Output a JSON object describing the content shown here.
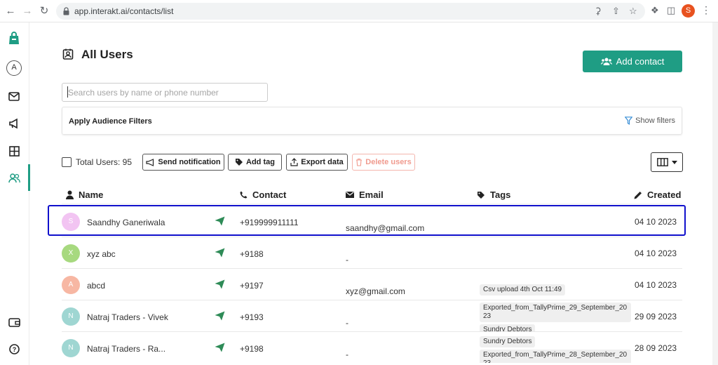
{
  "browser": {
    "url": "app.interakt.ai/contacts/list",
    "profile_initial": "S"
  },
  "page": {
    "title": "All Users",
    "add_contact_label": "Add contact"
  },
  "search": {
    "placeholder": "Search users by name or phone number"
  },
  "filters": {
    "label": "Apply Audience Filters",
    "show_label": "Show filters"
  },
  "toolbar": {
    "total_users": "Total Users: 95",
    "send_notification": "Send notification",
    "add_tag": "Add tag",
    "export_data": "Export data",
    "delete_users": "Delete users"
  },
  "columns": {
    "name": "Name",
    "contact": "Contact",
    "email": "Email",
    "tags": "Tags",
    "created": "Created"
  },
  "colors": {
    "accent": "#1f9d84",
    "highlight": "#1010cc",
    "delete_disabled": "#f09a8e"
  },
  "rows": [
    {
      "initial": "S",
      "name": "Saandhy Ganeriwala",
      "contact": "+919999911111",
      "email": "saandhy@gmail.com",
      "tags": [],
      "created": "04 10 2023",
      "avatar_color": "#f2c4f2"
    },
    {
      "initial": "X",
      "name": "xyz abc",
      "contact": "+9188",
      "email": "-",
      "tags": [],
      "created": "04 10 2023",
      "avatar_color": "#a7d97f"
    },
    {
      "initial": "A",
      "name": "abcd",
      "contact": "+9197",
      "email": "xyz@gmail.com",
      "tags": [
        "Csv upload 4th Oct 11:49"
      ],
      "created": "04 10 2023",
      "avatar_color": "#f7b7a3"
    },
    {
      "initial": "N",
      "name": "Natraj Traders - Vivek",
      "contact": "+9193",
      "email": "-",
      "tags": [
        "Exported_from_TallyPrime_29_September_2023",
        "Sundry Debtors"
      ],
      "created": "29 09 2023",
      "avatar_color": "#9fd6d2"
    },
    {
      "initial": "N",
      "name": "Natraj Traders - Ra...",
      "contact": "+9198",
      "email": "-",
      "tags": [
        "Sundry Debtors",
        "Exported_from_TallyPrime_28_September_2023"
      ],
      "created": "28 09 2023",
      "avatar_color": "#9fd6d2"
    }
  ]
}
